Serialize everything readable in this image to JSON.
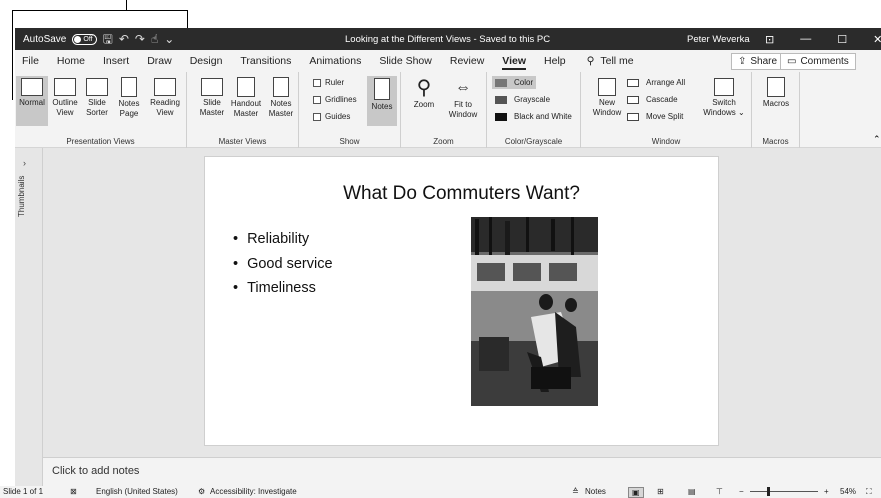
{
  "titlebar": {
    "autosave_label": "AutoSave",
    "autosave_state": "Off",
    "document_title": "Looking at the Different Views - Saved to this PC",
    "user_name": "Peter Weverka"
  },
  "tabs": [
    "File",
    "Home",
    "Insert",
    "Draw",
    "Design",
    "Transitions",
    "Animations",
    "Slide Show",
    "Review",
    "View",
    "Help"
  ],
  "active_tab": "View",
  "search_text": "Tell me",
  "share_label": "Share",
  "comments_label": "Comments",
  "ribbon": {
    "presentation_views": {
      "label": "Presentation Views",
      "buttons": [
        {
          "line1": "Normal",
          "line2": ""
        },
        {
          "line1": "Outline",
          "line2": "View"
        },
        {
          "line1": "Slide",
          "line2": "Sorter"
        },
        {
          "line1": "Notes",
          "line2": "Page"
        },
        {
          "line1": "Reading",
          "line2": "View"
        }
      ]
    },
    "master_views": {
      "label": "Master Views",
      "buttons": [
        {
          "line1": "Slide",
          "line2": "Master"
        },
        {
          "line1": "Handout",
          "line2": "Master"
        },
        {
          "line1": "Notes",
          "line2": "Master"
        }
      ]
    },
    "show": {
      "label": "Show",
      "ruler": "Ruler",
      "gridlines": "Gridlines",
      "guides": "Guides",
      "notes": "Notes"
    },
    "zoom": {
      "label": "Zoom",
      "zoom_btn": "Zoom",
      "fit_line1": "Fit to",
      "fit_line2": "Window"
    },
    "color": {
      "label": "Color/Grayscale",
      "color": "Color",
      "grayscale": "Grayscale",
      "bw": "Black and White"
    },
    "window": {
      "label": "Window",
      "new_line1": "New",
      "new_line2": "Window",
      "arrange": "Arrange All",
      "cascade": "Cascade",
      "move_split": "Move Split",
      "switch_line1": "Switch",
      "switch_line2": "Windows"
    },
    "macros": {
      "label": "Macros",
      "btn": "Macros"
    }
  },
  "sidebar": {
    "thumbnails_label": "Thumbnails"
  },
  "slide": {
    "title": "What Do Commuters Want?",
    "bullets": [
      "Reliability",
      "Good service",
      "Timeliness"
    ]
  },
  "notes_placeholder": "Click to add notes",
  "status": {
    "slide_info": "Slide 1 of 1",
    "language": "English (United States)",
    "accessibility": "Accessibility: Investigate",
    "notes": "Notes",
    "zoom": "54%"
  }
}
